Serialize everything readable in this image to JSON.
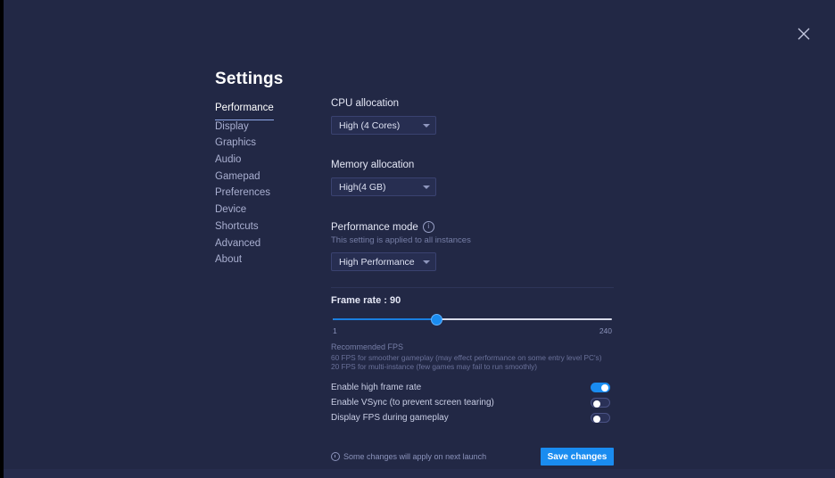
{
  "window": {
    "close_icon": "close-icon",
    "background_color": "#222845"
  },
  "page_title": "Settings",
  "sidebar": {
    "items": [
      {
        "label": "Performance",
        "active": true
      },
      {
        "label": "Display",
        "active": false
      },
      {
        "label": "Graphics",
        "active": false
      },
      {
        "label": "Audio",
        "active": false
      },
      {
        "label": "Gamepad",
        "active": false
      },
      {
        "label": "Preferences",
        "active": false
      },
      {
        "label": "Device",
        "active": false
      },
      {
        "label": "Shortcuts",
        "active": false
      },
      {
        "label": "Advanced",
        "active": false
      },
      {
        "label": "About",
        "active": false
      }
    ]
  },
  "main": {
    "cpu": {
      "label": "CPU allocation",
      "value": "High (4 Cores)"
    },
    "memory": {
      "label": "Memory allocation",
      "value": "High(4 GB)"
    },
    "performance_mode": {
      "label": "Performance mode",
      "info_icon": "info-icon",
      "hint": "This setting is applied to all instances",
      "value": "High Performance"
    },
    "frame_rate": {
      "title": "Frame rate : 90",
      "value": 90,
      "min": 1,
      "max": 240,
      "min_label": "1",
      "max_label": "240",
      "accent_color": "#1a8cf0"
    },
    "recommended": {
      "title": "Recommended FPS",
      "body": "60 FPS for smoother gameplay (may effect performance on some entry level PC's) 20 FPS for multi-instance (few games may fail to run smoothly)"
    },
    "toggles": [
      {
        "label": "Enable high frame rate",
        "on": true
      },
      {
        "label": "Enable VSync (to prevent screen tearing)",
        "on": false
      },
      {
        "label": "Display FPS during gameplay",
        "on": false
      }
    ],
    "footer": {
      "note_icon": "info-circle-icon",
      "note": "Some changes will apply on next launch",
      "save_label": "Save changes"
    }
  }
}
